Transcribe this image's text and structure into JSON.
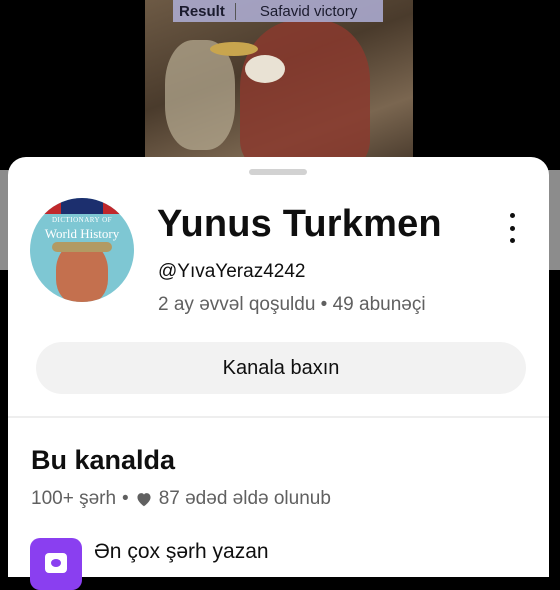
{
  "video": {
    "result_label": "Result",
    "result_value": "Safavid victory"
  },
  "channel": {
    "name": "Yunus Turkmen",
    "handle": "@YıvaYeraz4242",
    "meta": "2 ay əvvəl qoşuldu • 49 abunəçi",
    "avatar": {
      "line1": "DICTIONARY OF",
      "line2": "World History"
    },
    "view_button": "Kanala baxın"
  },
  "section": {
    "title": "Bu kanalda",
    "comments": "100+ şərh",
    "separator": "•",
    "likes": "87 ədəd əldə olunub",
    "item_label": "Ən çox şərh yazan"
  },
  "colors": {
    "accent_purple": "#8a3ff0",
    "text_primary": "#0f0f0f",
    "text_secondary": "#606060"
  },
  "icons": [
    "more-vert-icon",
    "heart-icon",
    "comment-heart-icon"
  ]
}
